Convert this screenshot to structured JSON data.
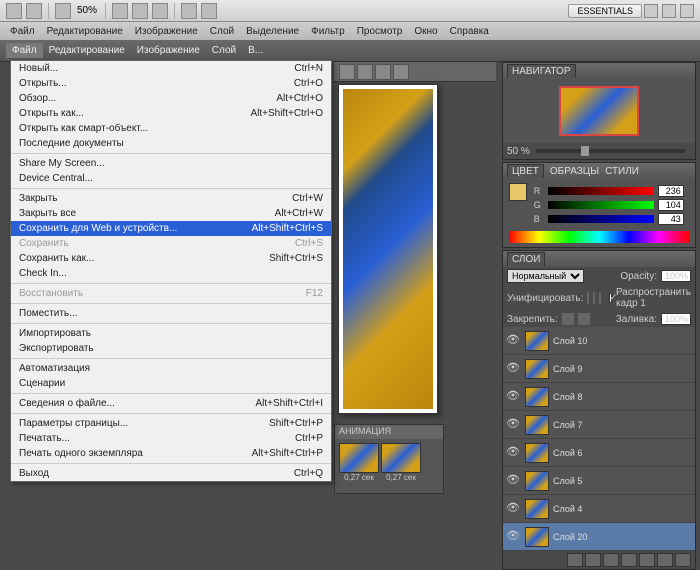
{
  "top": {
    "zoom": "50%",
    "badge": "ESSENTIALS"
  },
  "menu1": [
    "Файл",
    "Редактирование",
    "Изображение",
    "Слой",
    "Выделение",
    "Фильтр",
    "Просмотр",
    "Окно",
    "Справка"
  ],
  "menu2": [
    "Файл",
    "Редактирование",
    "Изображение",
    "Слой",
    "В..."
  ],
  "file_menu": [
    {
      "l": "Новый...",
      "s": "Ctrl+N"
    },
    {
      "l": "Открыть...",
      "s": "Ctrl+O"
    },
    {
      "l": "Обзор...",
      "s": "Alt+Ctrl+O"
    },
    {
      "l": "Открыть как...",
      "s": "Alt+Shift+Ctrl+O"
    },
    {
      "l": "Открыть как смарт-объект...",
      "s": ""
    },
    {
      "l": "Последние документы",
      "s": ""
    },
    {
      "sep": true
    },
    {
      "l": "Share My Screen...",
      "s": ""
    },
    {
      "l": "Device Central...",
      "s": ""
    },
    {
      "sep": true
    },
    {
      "l": "Закрыть",
      "s": "Ctrl+W"
    },
    {
      "l": "Закрыть все",
      "s": "Alt+Ctrl+W"
    },
    {
      "l": "Сохранить для Web и устройств...",
      "s": "Alt+Shift+Ctrl+S",
      "sel": true
    },
    {
      "l": "Сохранить",
      "s": "Ctrl+S",
      "dis": true
    },
    {
      "l": "Сохранить как...",
      "s": "Shift+Ctrl+S"
    },
    {
      "l": "Check In...",
      "s": ""
    },
    {
      "sep": true
    },
    {
      "l": "Восстановить",
      "s": "F12",
      "dis": true
    },
    {
      "sep": true
    },
    {
      "l": "Поместить...",
      "s": ""
    },
    {
      "sep": true
    },
    {
      "l": "Импортировать",
      "s": ""
    },
    {
      "l": "Экспортировать",
      "s": ""
    },
    {
      "sep": true
    },
    {
      "l": "Автоматизация",
      "s": ""
    },
    {
      "l": "Сценарии",
      "s": ""
    },
    {
      "sep": true
    },
    {
      "l": "Сведения о файле...",
      "s": "Alt+Shift+Ctrl+I"
    },
    {
      "sep": true
    },
    {
      "l": "Параметры страницы...",
      "s": "Shift+Ctrl+P"
    },
    {
      "l": "Печатать...",
      "s": "Ctrl+P"
    },
    {
      "l": "Печать одного экземпляра",
      "s": "Alt+Shift+Ctrl+P"
    },
    {
      "sep": true
    },
    {
      "l": "Выход",
      "s": "Ctrl+Q"
    }
  ],
  "nav": {
    "title": "НАВИГАТОР",
    "zoom": "50 %"
  },
  "color": {
    "tabs": [
      "ЦВЕТ",
      "ОБРАЗЦЫ",
      "СТИЛИ"
    ],
    "r": "236",
    "g": "104",
    "b": "43"
  },
  "layers": {
    "title": "СЛОИ",
    "blend": "Нормальный",
    "opacity_l": "Opacity:",
    "opacity": "100%",
    "unif": "Унифицировать:",
    "prop": "Распространить кадр 1",
    "lock": "Закрепить:",
    "fill_l": "Заливка:",
    "fill": "100%",
    "items": [
      {
        "n": "Слой 10"
      },
      {
        "n": "Слой 9"
      },
      {
        "n": "Слой 8"
      },
      {
        "n": "Слой 7"
      },
      {
        "n": "Слой 6"
      },
      {
        "n": "Слой 5"
      },
      {
        "n": "Слой 4"
      },
      {
        "n": "Слой 20",
        "sel": true
      }
    ]
  },
  "anim": {
    "title": "АНИМАЦИЯ",
    "t1": "0,27 сек",
    "t2": "0,27 сек"
  }
}
